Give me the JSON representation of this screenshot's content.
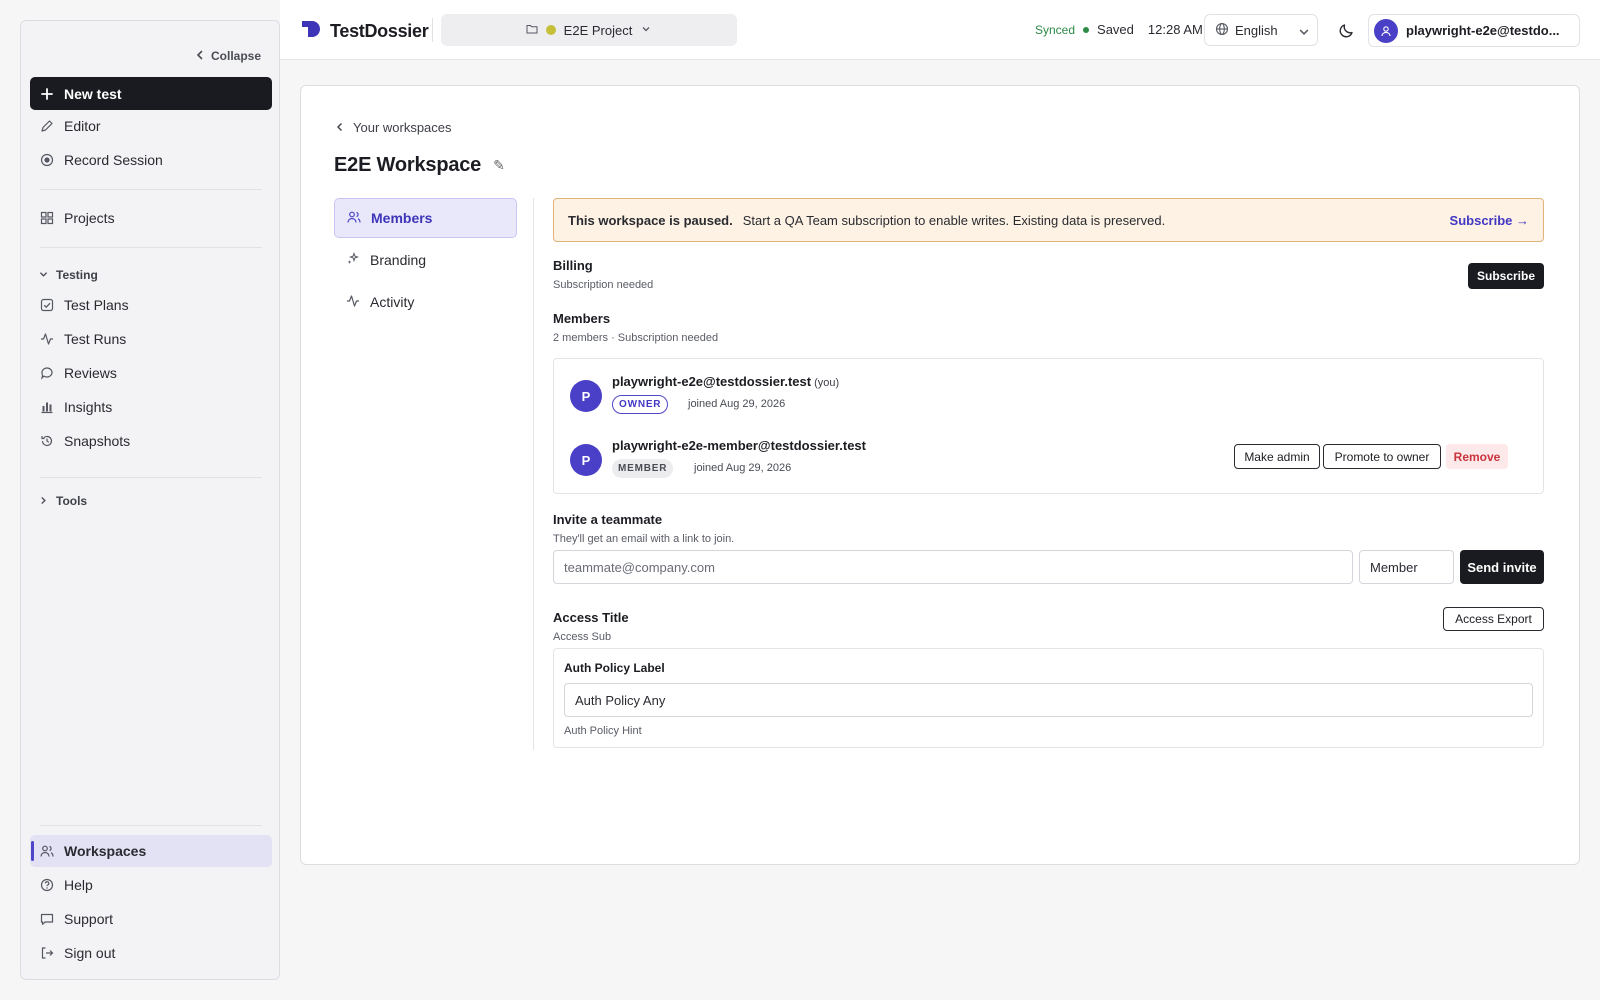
{
  "sidebar": {
    "collapse_label": "Collapse",
    "new_test": "New test",
    "editor": "Editor",
    "record_session": "Record Session",
    "projects": "Projects",
    "testing_section": "Testing",
    "test_plans": "Test Plans",
    "test_runs": "Test Runs",
    "reviews": "Reviews",
    "insights": "Insights",
    "snapshots": "Snapshots",
    "tools_section": "Tools",
    "workspaces": "Workspaces",
    "help": "Help",
    "support": "Support",
    "sign_out": "Sign out"
  },
  "header": {
    "app_name": "TestDossier",
    "project_name": "E2E Project",
    "sync_status": "Synced",
    "save_status": "Saved",
    "time": "12:28 AM",
    "language": "English",
    "user_email": "playwright-e2e@testdo..."
  },
  "page": {
    "back_label": "Your workspaces",
    "title": "E2E Workspace",
    "edit_glyph": "✎",
    "tabs": [
      {
        "label": "Members",
        "active": true
      },
      {
        "label": "Branding",
        "active": false
      },
      {
        "label": "Activity",
        "active": false
      }
    ]
  },
  "banner": {
    "bold": "This workspace is paused.",
    "text": "Start a QA Team subscription to enable writes. Existing data is preserved.",
    "link": "Subscribe →"
  },
  "billing": {
    "title": "Billing",
    "subtitle": "Subscription needed",
    "button": "Subscribe"
  },
  "members": {
    "title": "Members",
    "subtitle": "2 members · Subscription needed",
    "rows": [
      {
        "initial": "P",
        "email": "playwright-e2e@testdossier.test",
        "you": "(you)",
        "role": "OWNER",
        "joined": "joined Aug 29, 2026"
      },
      {
        "initial": "P",
        "email": "playwright-e2e-member@testdossier.test",
        "you": "",
        "role": "MEMBER",
        "joined": "joined Aug 29, 2026"
      }
    ],
    "actions": {
      "make_admin": "Make admin",
      "promote": "Promote to owner",
      "remove": "Remove"
    }
  },
  "invite": {
    "title": "Invite a teammate",
    "subtitle": "They'll get an email with a link to join.",
    "email_placeholder": "teammate@company.com",
    "role_value": "Member",
    "button": "Send invite"
  },
  "access": {
    "title": "Access Title",
    "subtitle": "Access Sub",
    "export_button": "Access Export",
    "policy_label": "Auth Policy Label",
    "policy_value": "Auth Policy Any",
    "policy_hint": "Auth Policy Hint"
  },
  "colors": {
    "accent": "#4e46c7",
    "dark": "#1a1b20",
    "banner_bg": "#fdf2e3",
    "banner_border": "#e2b47a",
    "synced": "#2e8a47",
    "danger": "#c9343d"
  }
}
